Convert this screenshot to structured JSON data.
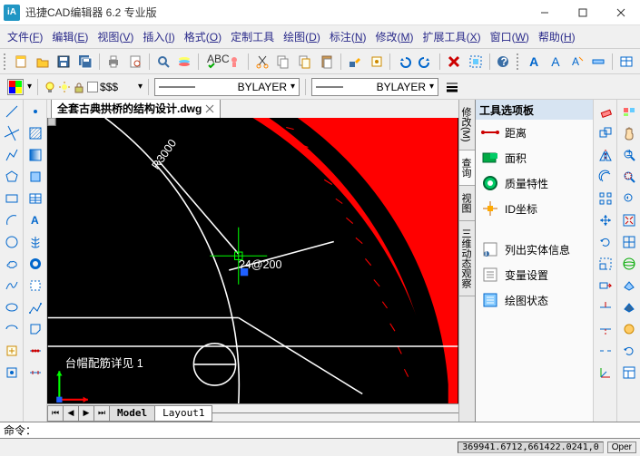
{
  "title": "迅捷CAD编辑器 6.2 专业版",
  "menu": {
    "file": {
      "label": "文件",
      "key": "F"
    },
    "edit": {
      "label": "编辑",
      "key": "E"
    },
    "view": {
      "label": "视图",
      "key": "V"
    },
    "insert": {
      "label": "插入",
      "key": "I"
    },
    "format": {
      "label": "格式",
      "key": "O"
    },
    "custom": {
      "label": "定制工具"
    },
    "draw": {
      "label": "绘图",
      "key": "D"
    },
    "annot": {
      "label": "标注",
      "key": "N"
    },
    "modify": {
      "label": "修改",
      "key": "M"
    },
    "ext": {
      "label": "扩展工具",
      "key": "X"
    },
    "window": {
      "label": "窗口",
      "key": "W"
    },
    "help": {
      "label": "帮助",
      "key": "H"
    }
  },
  "layerprops": {
    "label": "$$$",
    "linetype": "BYLAYER",
    "lineweight": "BYLAYER"
  },
  "doc": {
    "tab": "全套古典拱桥的结构设计.dwg",
    "annotation_r": "R3000",
    "annotation_spacing": "?4@200",
    "annotation_note": "台帽配筋详见 1",
    "model_tab": "Model",
    "layout_tab": "Layout1"
  },
  "palette": {
    "title": "工具选项板",
    "items": [
      {
        "label": "距离"
      },
      {
        "label": "面积"
      },
      {
        "label": "质量特性"
      },
      {
        "label": "ID坐标"
      },
      {
        "label": "列出实体信息"
      },
      {
        "label": "变量设置"
      },
      {
        "label": "绘图状态"
      }
    ],
    "tabs": [
      "修改(M)",
      "查询",
      "视图",
      "三维动态观察"
    ]
  },
  "cmd": {
    "prompt": "命令："
  },
  "status": {
    "coords": "369941.6712,661422.0241,0",
    "oper": "Oper"
  }
}
